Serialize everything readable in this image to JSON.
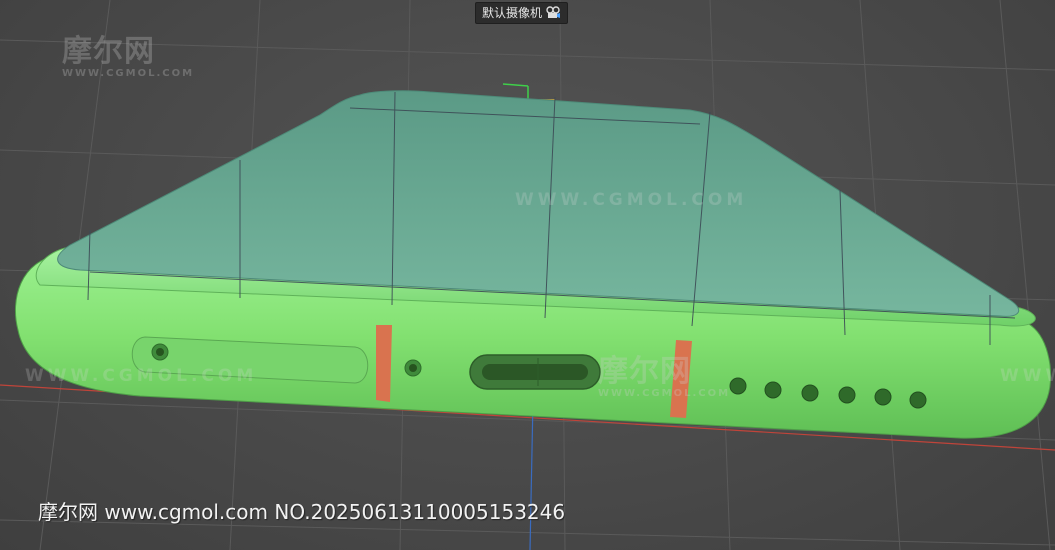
{
  "viewport": {
    "camera_label": "默认摄像机",
    "camera_icon": "camera-icon"
  },
  "watermarks": {
    "logo_cn": "摩尔网",
    "logo_en": "WWW.CGMOL.COM",
    "site_text": "WWW.CGMOL.COM"
  },
  "footer": {
    "brand": "摩尔网",
    "url": "www.cgmol.com",
    "serial": "NO.20250613110005153246"
  },
  "model": {
    "description_colors": {
      "body": "#7ee07a",
      "screen": "#6cae98",
      "seam": "#d9734f"
    }
  },
  "colors": {
    "background": "#4a4a4a",
    "grid": "#5c5c5c",
    "axis_x": "#c0443a",
    "axis_y": "#3a6cc0"
  }
}
